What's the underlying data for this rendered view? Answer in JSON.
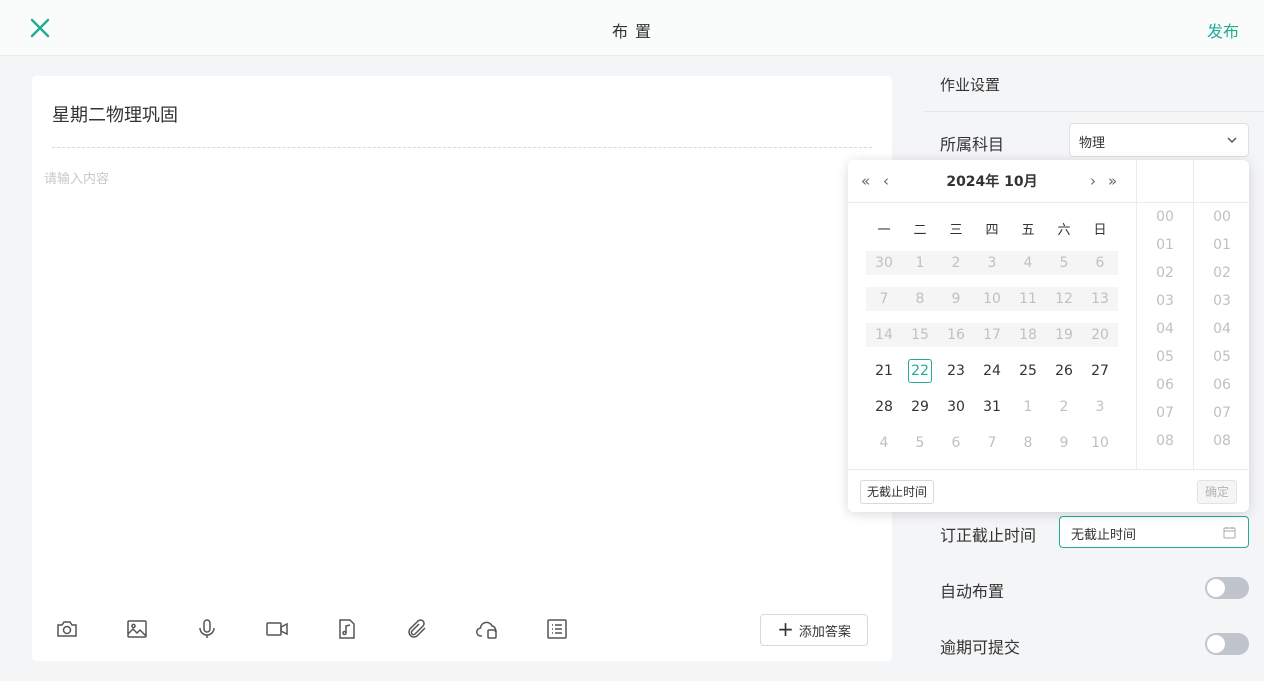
{
  "header": {
    "title": "布 置",
    "publish_label": "发布"
  },
  "editor": {
    "doc_title": "星期二物理巩固",
    "content_placeholder": "请输入内容",
    "add_answer_label": "添加答案",
    "toolbar_icons": [
      "camera-icon",
      "image-icon",
      "microphone-icon",
      "video-icon",
      "audio-file-icon",
      "attachment-icon",
      "cloud-file-icon",
      "list-icon"
    ]
  },
  "settings": {
    "heading": "作业设置",
    "subject_label": "所属科目",
    "subject_value": "物理",
    "correction_deadline_label": "订正截止时间",
    "correction_deadline_value": "无截止时间",
    "auto_assign_label": "自动布置",
    "late_submit_label": "逾期可提交",
    "auto_assign_on": false,
    "late_submit_on": false
  },
  "date_picker": {
    "year_month": "2024年  10月",
    "weekdays": [
      "一",
      "二",
      "三",
      "四",
      "五",
      "六",
      "日"
    ],
    "weeks": [
      [
        "30",
        "1",
        "2",
        "3",
        "4",
        "5",
        "6"
      ],
      [
        "7",
        "8",
        "9",
        "10",
        "11",
        "12",
        "13"
      ],
      [
        "14",
        "15",
        "16",
        "17",
        "18",
        "19",
        "20"
      ],
      [
        "21",
        "22",
        "23",
        "24",
        "25",
        "26",
        "27"
      ],
      [
        "28",
        "29",
        "30",
        "31",
        "1",
        "2",
        "3"
      ],
      [
        "4",
        "5",
        "6",
        "7",
        "8",
        "9",
        "10"
      ]
    ],
    "today": "22",
    "hours": [
      "00",
      "01",
      "02",
      "03",
      "04",
      "05",
      "06",
      "07",
      "08"
    ],
    "minutes": [
      "00",
      "01",
      "02",
      "03",
      "04",
      "05",
      "06",
      "07",
      "08"
    ],
    "no_deadline_label": "无截止时间",
    "confirm_label": "确定"
  },
  "colors": {
    "accent": "#22ab95",
    "disabled_bg": "#f5f5f5",
    "muted_text": "#c0c0c0"
  }
}
